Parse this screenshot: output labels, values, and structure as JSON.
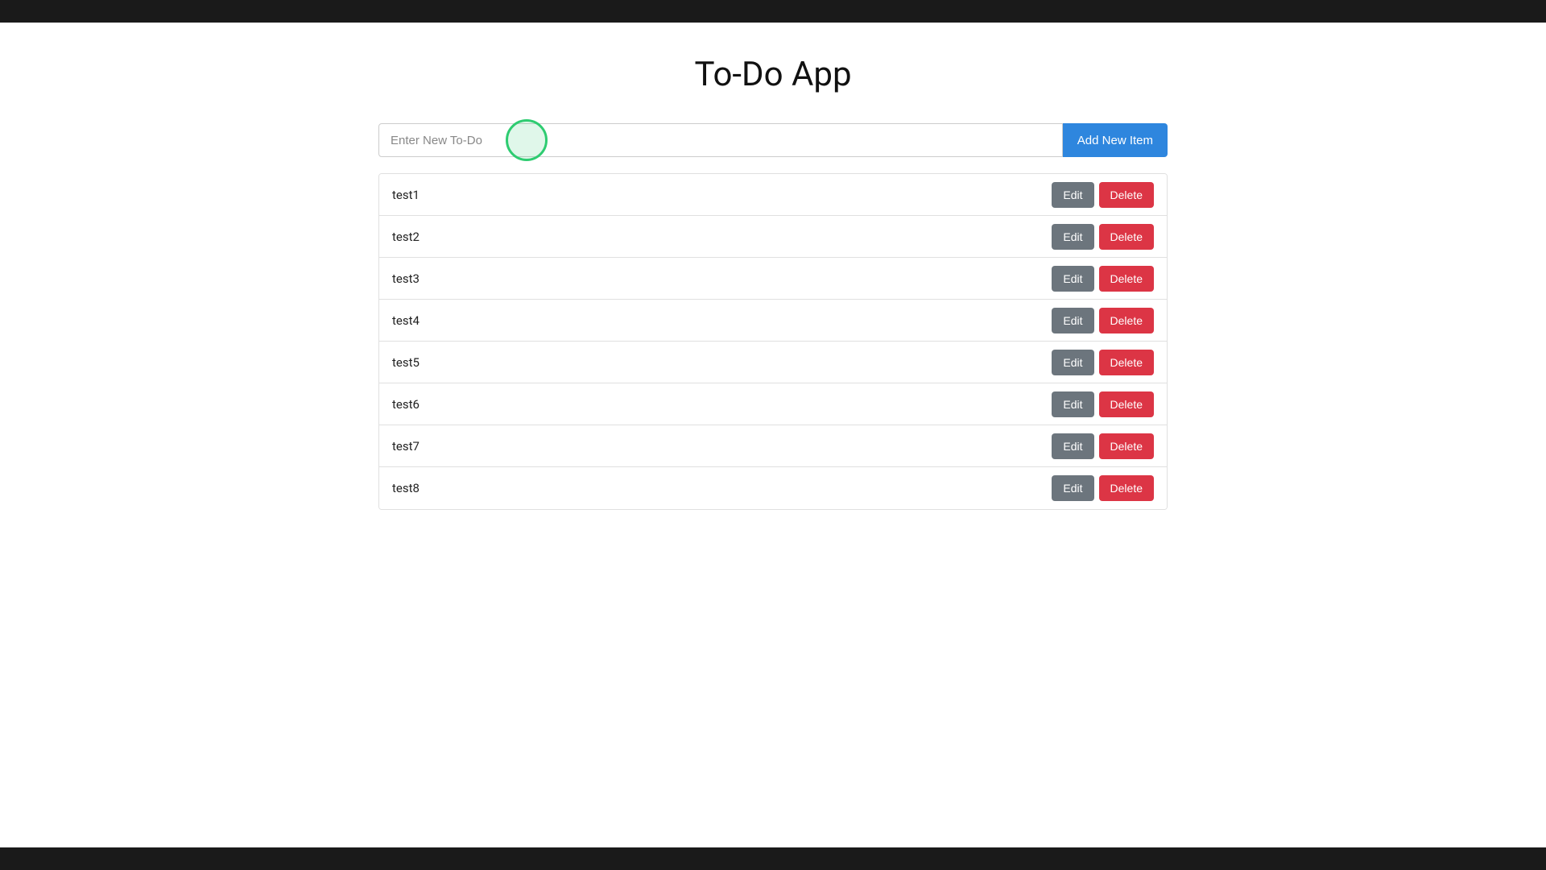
{
  "page": {
    "title": "To-Do App",
    "top_bar_color": "#1a1a1a",
    "bottom_bar_color": "#1a1a1a"
  },
  "input": {
    "placeholder": "Enter New To-Do",
    "value": ""
  },
  "add_button": {
    "label": "Add New Item"
  },
  "edit_button": {
    "label": "Edit"
  },
  "delete_button": {
    "label": "Delete"
  },
  "todo_items": [
    {
      "id": 1,
      "text": "test1"
    },
    {
      "id": 2,
      "text": "test2"
    },
    {
      "id": 3,
      "text": "test3"
    },
    {
      "id": 4,
      "text": "test4"
    },
    {
      "id": 5,
      "text": "test5"
    },
    {
      "id": 6,
      "text": "test6"
    },
    {
      "id": 7,
      "text": "test7"
    },
    {
      "id": 8,
      "text": "test8"
    }
  ]
}
